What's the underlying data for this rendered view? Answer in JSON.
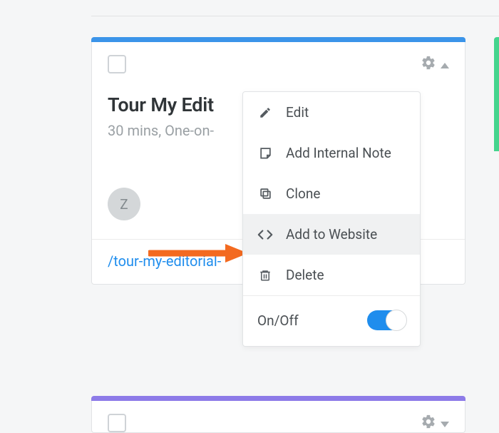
{
  "card": {
    "title": "Tour My Edit",
    "subtitle": "30 mins, One-on-",
    "avatar_initial": "Z",
    "link_text": "/tour-my-editorial-",
    "accent_color": "#3b94e9"
  },
  "dropdown": {
    "items": [
      {
        "label": "Edit",
        "icon": "pencil-icon"
      },
      {
        "label": "Add Internal Note",
        "icon": "note-icon"
      },
      {
        "label": "Clone",
        "icon": "clone-icon"
      },
      {
        "label": "Add to Website",
        "icon": "code-icon",
        "highlighted": true
      },
      {
        "label": "Delete",
        "icon": "trash-icon"
      }
    ],
    "toggle_label": "On/Off",
    "toggle_state": true
  },
  "card2": {
    "accent_color": "#8d7be8"
  },
  "colors": {
    "link": "#1f8ded",
    "arrow": "#f36a20"
  }
}
